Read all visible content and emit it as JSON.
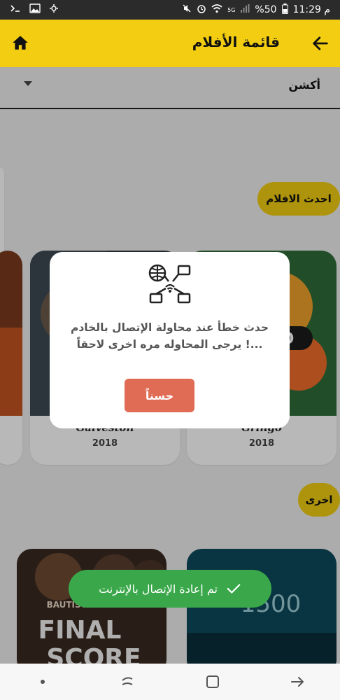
{
  "status_bar": {
    "time": "11:29 م",
    "battery": "%50",
    "network": "5G"
  },
  "app_bar": {
    "title": "قائمة الأفلام"
  },
  "filter": {
    "selected_genre": "أكشن"
  },
  "sections": {
    "latest_label": "احدث الافلام",
    "other_label": "اخرى"
  },
  "movies_latest": [
    {
      "title": "Gringo",
      "year": "2018"
    },
    {
      "title": "Galveston",
      "year": "2018"
    }
  ],
  "movies_other": [
    {
      "title": "1500"
    },
    {
      "title": "Final Score"
    }
  ],
  "dialog": {
    "message": "حدث خطأ عند محاولة الإتصال بالخادم ...! يرجى المحاوله مره اخرى لاحقاً",
    "ok_label": "حسناً"
  },
  "toast": {
    "message": "تم إعادة الإتصال بالإنترنت"
  },
  "colors": {
    "accent": "#f2cd12",
    "button": "#e06c55",
    "toast": "#3aa84a"
  },
  "poster_text": {
    "final_top": "BAUTISTA STE",
    "final_line1": "FINAL",
    "final_line2": "SCORE",
    "num": "1500",
    "go": "GO"
  }
}
